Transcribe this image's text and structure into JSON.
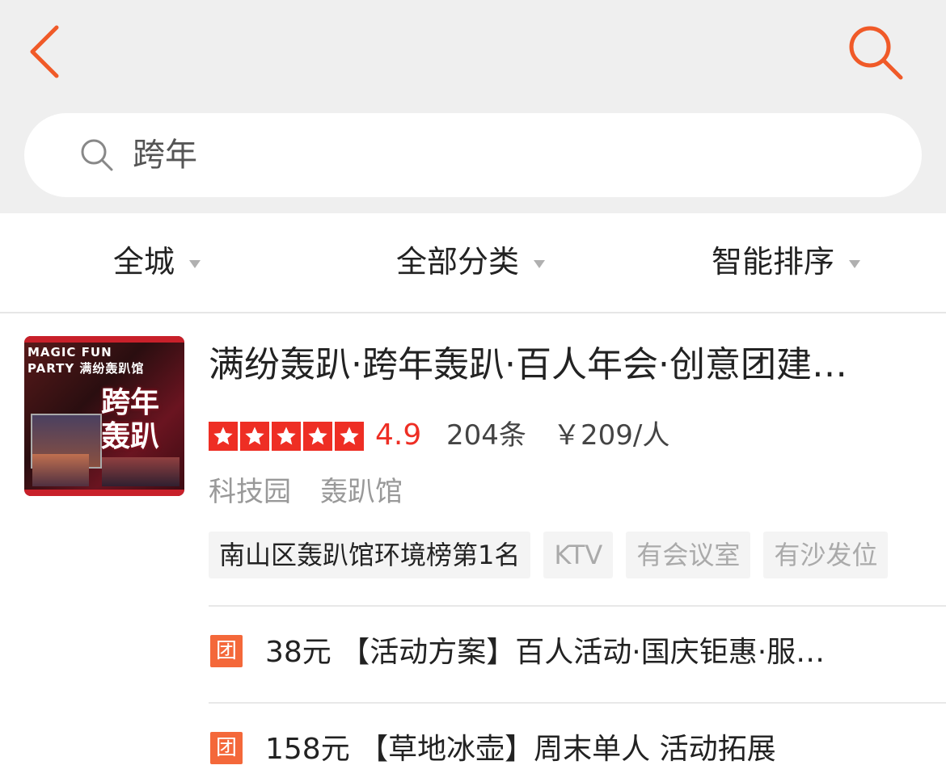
{
  "header": {
    "search_query": "跨年",
    "accent_color": "#f05a28"
  },
  "filters": [
    {
      "label": "全城"
    },
    {
      "label": "全部分类"
    },
    {
      "label": "智能排序"
    }
  ],
  "listing": {
    "thumbnail": {
      "line1": "MAGIC FUN",
      "line2": "PARTY 满纷轰趴馆",
      "big_text_1": "跨年",
      "big_text_2": "轰趴"
    },
    "title": "满纷轰趴·跨年轰趴·百人年会·创意团建…",
    "stars": 5,
    "rating": "4.9",
    "reviews": "204条",
    "price": "￥209/人",
    "area": "科技园",
    "category": "轰趴馆",
    "tags": [
      {
        "label": "南山区轰趴馆环境榜第1名",
        "style": "dark"
      },
      {
        "label": "KTV",
        "style": "light"
      },
      {
        "label": "有会议室",
        "style": "light"
      },
      {
        "label": "有沙发位",
        "style": "light"
      }
    ],
    "deals": [
      {
        "badge": "团",
        "text": "38元 【活动方案】百人活动·国庆钜惠·服…"
      },
      {
        "badge": "团",
        "text": "158元 【草地冰壶】周末单人 活动拓展"
      }
    ]
  }
}
